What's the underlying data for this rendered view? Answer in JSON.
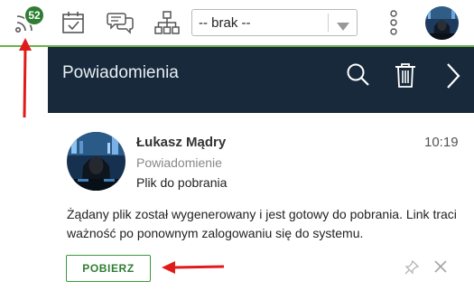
{
  "toolbar": {
    "feed_badge_count": "52",
    "select": {
      "value": "-- brak --"
    },
    "accent_color": "#6bb24a"
  },
  "panel": {
    "title": "Powiadomienia",
    "header_color": "#17293a"
  },
  "notification": {
    "sender": "Łukasz Mądry",
    "time": "10:19",
    "type": "Powiadomienie",
    "subject": "Plik do pobrania",
    "body": "Żądany plik został wygenerowany i jest gotowy do pobrania. Link traci ważność po ponownym zalogowaniu się do systemu.",
    "download_label": "POBIERZ"
  },
  "annotations": {
    "arrow_color": "#e01b1b"
  },
  "icons": [
    "rss-feed-icon",
    "calendar-icon",
    "chat-icon",
    "org-chart-icon",
    "chevron-down-icon",
    "kebab-menu-icon",
    "user-avatar",
    "search-icon",
    "trash-icon",
    "chevron-right-icon",
    "pin-icon",
    "close-icon"
  ]
}
